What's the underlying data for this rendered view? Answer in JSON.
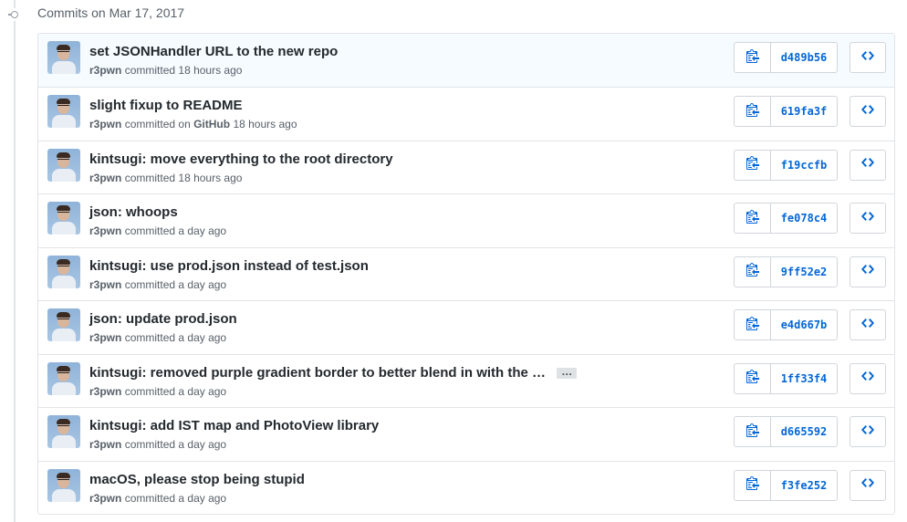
{
  "group": {
    "title": "Commits on Mar 17, 2017"
  },
  "ellipsis_label": "…",
  "commits": [
    {
      "title": "set JSONHandler URL to the new repo",
      "author": "r3pwn",
      "committed": "committed",
      "on_label": "",
      "platform": "",
      "time": "18 hours ago",
      "sha": "d489b56",
      "truncated": false
    },
    {
      "title": "slight fixup to README",
      "author": "r3pwn",
      "committed": "committed",
      "on_label": "on",
      "platform": "GitHub",
      "time": "18 hours ago",
      "sha": "619fa3f",
      "truncated": false
    },
    {
      "title": "kintsugi: move everything to the root directory",
      "author": "r3pwn",
      "committed": "committed",
      "on_label": "",
      "platform": "",
      "time": "18 hours ago",
      "sha": "f19ccfb",
      "truncated": false
    },
    {
      "title": "json: whoops",
      "author": "r3pwn",
      "committed": "committed",
      "on_label": "",
      "platform": "",
      "time": "a day ago",
      "sha": "fe078c4",
      "truncated": false
    },
    {
      "title": "kintsugi: use prod.json instead of test.json",
      "author": "r3pwn",
      "committed": "committed",
      "on_label": "",
      "platform": "",
      "time": "a day ago",
      "sha": "9ff52e2",
      "truncated": false
    },
    {
      "title": "json: update prod.json",
      "author": "r3pwn",
      "committed": "committed",
      "on_label": "",
      "platform": "",
      "time": "a day ago",
      "sha": "e4d667b",
      "truncated": false
    },
    {
      "title": "kintsugi: removed purple gradient border to better blend in with the …",
      "author": "r3pwn",
      "committed": "committed",
      "on_label": "",
      "platform": "",
      "time": "a day ago",
      "sha": "1ff33f4",
      "truncated": true
    },
    {
      "title": "kintsugi: add IST map and PhotoView library",
      "author": "r3pwn",
      "committed": "committed",
      "on_label": "",
      "platform": "",
      "time": "a day ago",
      "sha": "d665592",
      "truncated": false
    },
    {
      "title": "macOS, please stop being stupid",
      "author": "r3pwn",
      "committed": "committed",
      "on_label": "",
      "platform": "",
      "time": "a day ago",
      "sha": "f3fe252",
      "truncated": false
    }
  ],
  "icons": {
    "commit_node": "git-commit-icon",
    "copy": "clippy-icon",
    "browse": "code-icon"
  },
  "colors": {
    "link": "#0366d6",
    "highlight_row": "#f6fbff",
    "border": "#e1e4e8"
  }
}
